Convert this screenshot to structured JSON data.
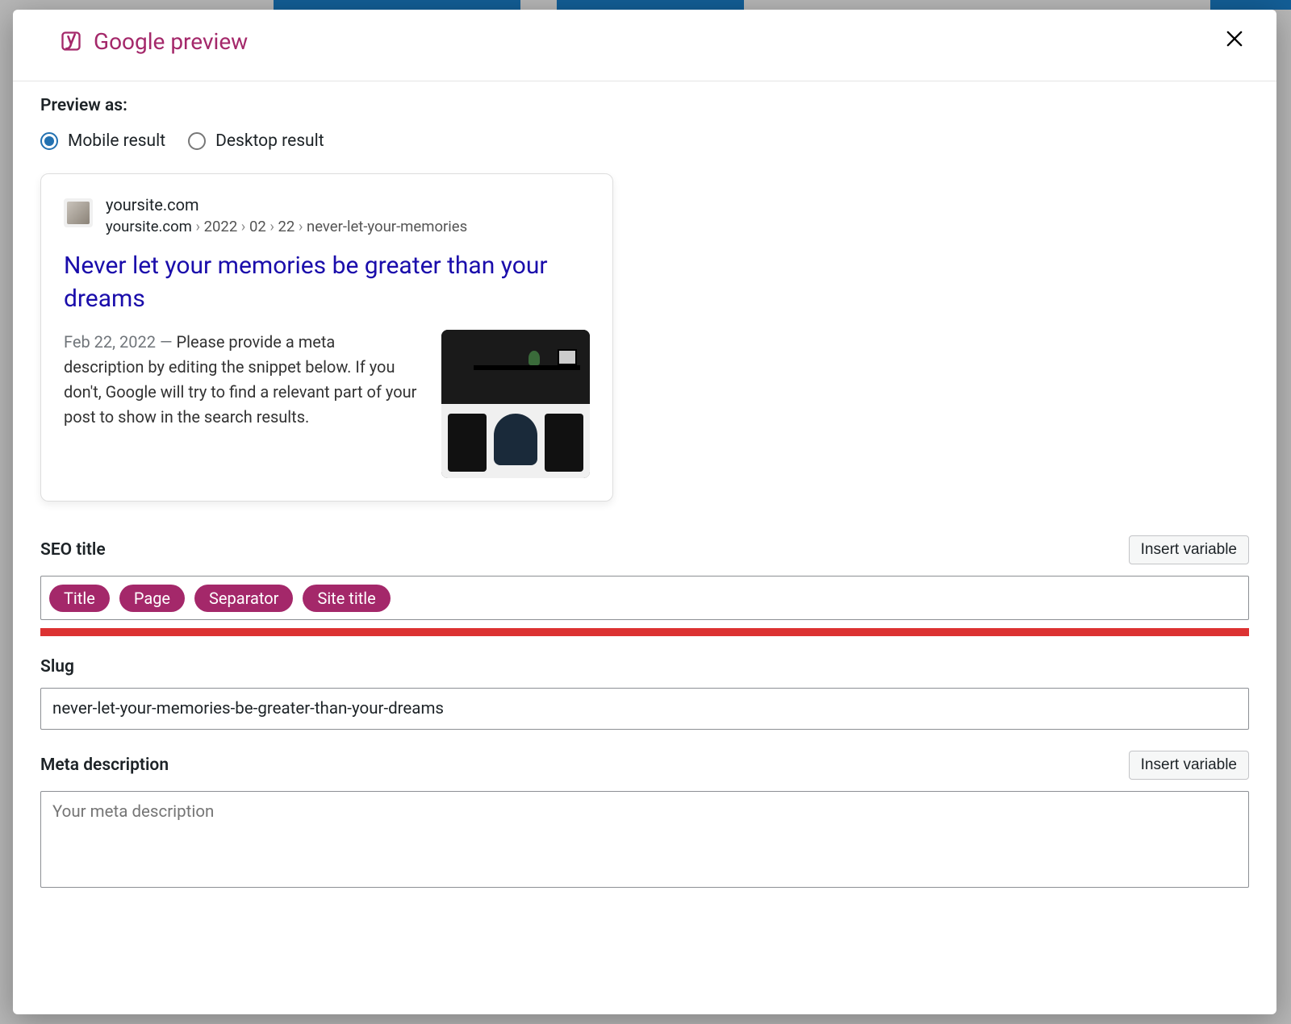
{
  "modal": {
    "title": "Google preview"
  },
  "preview_as": {
    "label": "Preview as:",
    "options": [
      {
        "label": "Mobile result",
        "selected": true
      },
      {
        "label": "Desktop result",
        "selected": false
      }
    ]
  },
  "serp": {
    "domain": "yoursite.com",
    "breadcrumb_first": "yoursite.com",
    "breadcrumb_parts": [
      "2022",
      "02",
      "22",
      "never-let-your-memories"
    ],
    "title": "Never let your memories be greater than your dreams",
    "date": "Feb 22, 2022",
    "description": "Please provide a meta description by editing the snippet below. If you don't, Google will try to find a relevant part of your post to show in the search results."
  },
  "seo_title": {
    "label": "SEO title",
    "insert_variable_label": "Insert variable",
    "tokens": [
      "Title",
      "Page",
      "Separator",
      "Site title"
    ]
  },
  "slug": {
    "label": "Slug",
    "value": "never-let-your-memories-be-greater-than-your-dreams"
  },
  "meta_description": {
    "label": "Meta description",
    "insert_variable_label": "Insert variable",
    "placeholder": "Your meta description"
  }
}
